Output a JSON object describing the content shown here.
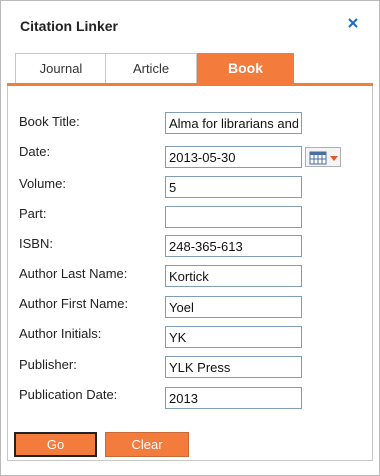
{
  "dialog": {
    "title": "Citation Linker"
  },
  "tabs": [
    {
      "label": "Journal"
    },
    {
      "label": "Article"
    },
    {
      "label": "Book"
    }
  ],
  "form": {
    "book_title": {
      "label": "Book Title:",
      "value": "Alma for librarians and"
    },
    "date": {
      "label": "Date:",
      "value": "2013-05-30"
    },
    "volume": {
      "label": "Volume:",
      "value": "5"
    },
    "part": {
      "label": "Part:",
      "value": ""
    },
    "isbn": {
      "label": "ISBN:",
      "value": "248-365-613"
    },
    "author_last": {
      "label": "Author Last Name:",
      "value": "Kortick"
    },
    "author_first": {
      "label": "Author First Name:",
      "value": "Yoel"
    },
    "author_initials": {
      "label": "Author Initials:",
      "value": "YK"
    },
    "publisher": {
      "label": "Publisher:",
      "value": "YLK Press"
    },
    "publication_date": {
      "label": "Publication Date:",
      "value": "2013"
    }
  },
  "buttons": {
    "go": "Go",
    "clear": "Clear"
  },
  "colors": {
    "accent": "#f37b3b",
    "close": "#1a6fc4"
  },
  "icons": {
    "close": "close-icon",
    "calendar": "calendar-icon",
    "dropdown": "chevron-down-icon"
  }
}
